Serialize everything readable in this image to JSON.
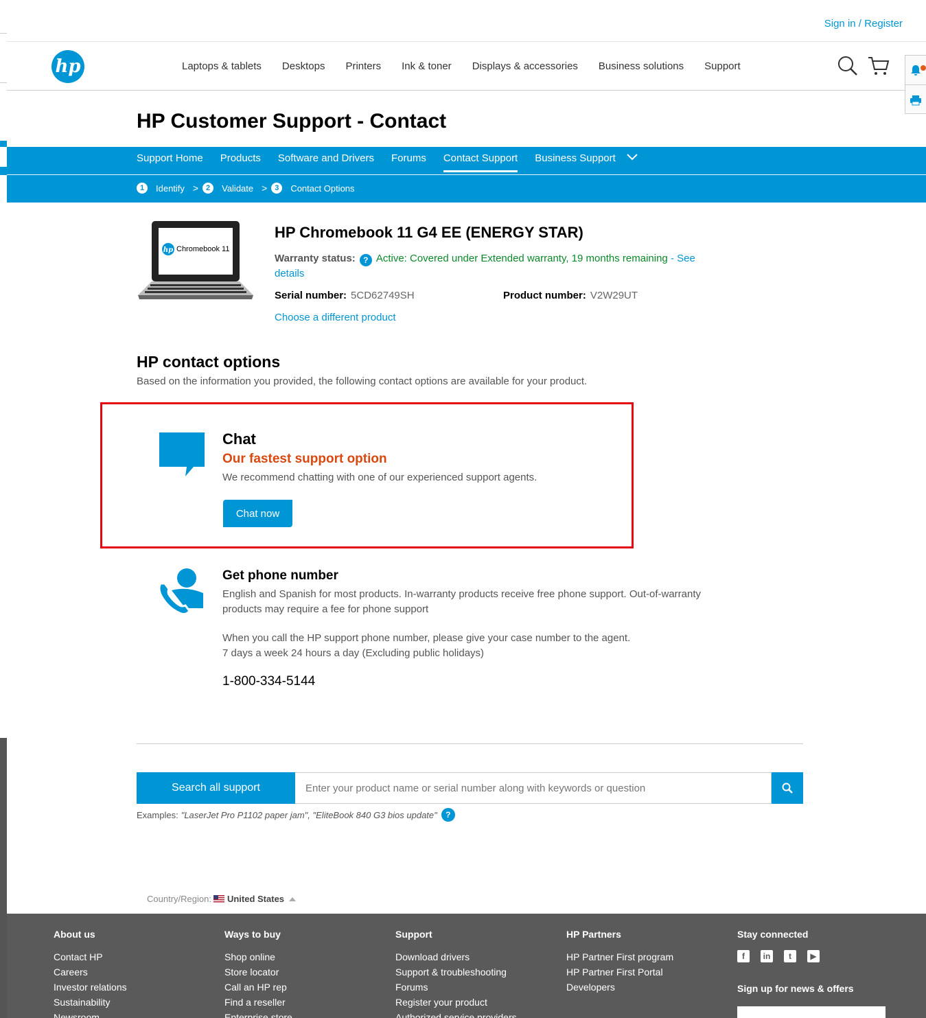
{
  "topbar": {
    "signin": "Sign in",
    "sep": " / ",
    "register": "Register"
  },
  "header": {
    "logo_text": "hp",
    "nav": [
      "Laptops & tablets",
      "Desktops",
      "Printers",
      "Ink & toner",
      "Displays & accessories",
      "Business solutions",
      "Support"
    ]
  },
  "page_title": "HP Customer Support - Contact",
  "subnav": {
    "tabs": [
      "Support Home",
      "Products",
      "Software and Drivers",
      "Forums",
      "Contact Support",
      "Business Support"
    ],
    "active_tab": "Contact Support",
    "steps": [
      {
        "num": "1",
        "label": "Identify"
      },
      {
        "num": "2",
        "label": "Validate"
      },
      {
        "num": "3",
        "label": "Contact Options"
      }
    ]
  },
  "product": {
    "image_caption": "Chromebook 11",
    "name": "HP Chromebook 11 G4 EE (ENERGY STAR)",
    "warranty_label": "Warranty status:",
    "warranty_value": "Active: Covered under Extended warranty,  19  months remaining",
    "see_details": "- See details",
    "serial_label": "Serial number:",
    "serial_value": "5CD62749SH",
    "product_label": "Product number:",
    "product_value": "V2W29UT",
    "choose_link": "Choose a different product"
  },
  "contact": {
    "title": "HP contact options",
    "subtitle": "Based on the information you provided, the following contact options are available for your product.",
    "chat": {
      "title": "Chat",
      "tagline": "Our fastest support option",
      "desc": "We recommend chatting with one of our experienced support agents.",
      "button": "Chat now"
    },
    "phone": {
      "title": "Get phone number",
      "desc": "English and Spanish for most products. In-warranty products receive free phone support. Out-of-warranty products may require a fee for phone support",
      "call_line1": "When you call the HP support phone number, please give your case number to the agent.",
      "call_line2": "7 days a week 24 hours a day (Excluding public holidays)",
      "number": "1-800-334-5144"
    }
  },
  "search": {
    "label": "Search all support",
    "placeholder": "Enter your product name or serial number along with keywords or question",
    "examples_prefix": "Examples:",
    "examples_text": "\"LaserJet Pro P1102 paper jam\", \"EliteBook 840 G3 bios update\""
  },
  "country": {
    "label": "Country/Region:",
    "value": "United States"
  },
  "footer": {
    "columns": [
      {
        "title": "About us",
        "items": [
          "Contact HP",
          "Careers",
          "Investor relations",
          "Sustainability",
          "Newsroom"
        ]
      },
      {
        "title": "Ways to buy",
        "items": [
          "Shop online",
          "Store locator",
          "Call an HP rep",
          "Find a reseller",
          "Enterprise store"
        ]
      },
      {
        "title": "Support",
        "items": [
          "Download drivers",
          "Support & troubleshooting",
          "Forums",
          "Register your product",
          "Authorized service providers"
        ]
      },
      {
        "title": "HP Partners",
        "items": [
          "HP Partner First program",
          "HP Partner First Portal",
          "Developers"
        ]
      }
    ],
    "stay_connected": "Stay connected",
    "social_icons": [
      "facebook-icon",
      "linkedin-icon",
      "twitter-icon",
      "youtube-icon"
    ],
    "signup": "Sign up for news & offers"
  },
  "colors": {
    "brand": "#0096d6",
    "chat_tagline": "#d9480f",
    "warranty_active": "#0a8a2a",
    "highlight_box": "#e30613",
    "footer_bg": "#5a5a5a"
  }
}
